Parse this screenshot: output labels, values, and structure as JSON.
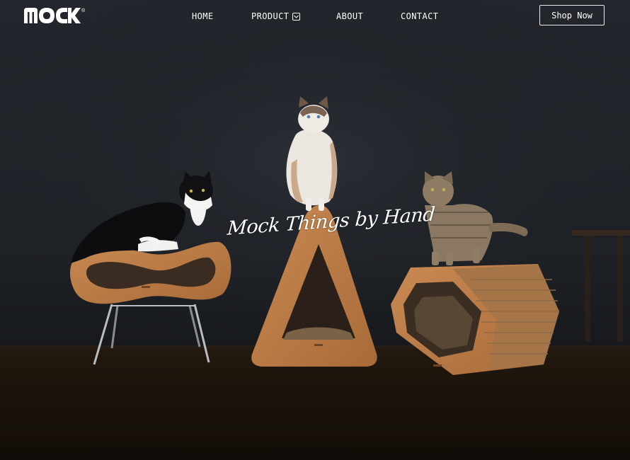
{
  "header": {
    "logo_text": "MOCK",
    "logo_reg": "®",
    "nav": [
      {
        "label": "HOME"
      },
      {
        "label": "PRODUCT",
        "icon": "chevron-down-icon"
      },
      {
        "label": "ABOUT"
      },
      {
        "label": "CONTACT"
      }
    ],
    "shop_button": "Shop Now"
  },
  "hero": {
    "tagline": "Mock Things by Hand",
    "image": "three cats on cardboard cat furniture against dark wall",
    "colors": {
      "background": "#1e2126",
      "floor": "#1a120d",
      "cardboard": "#b97a45"
    }
  }
}
